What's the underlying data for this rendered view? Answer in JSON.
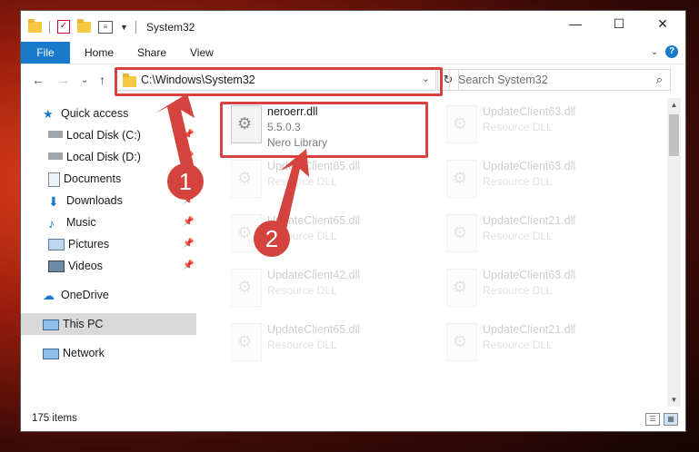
{
  "window": {
    "title": "System32"
  },
  "qat": {
    "icons": [
      "folder-icon",
      "properties-check-icon",
      "new-folder-icon",
      "customize-icon"
    ]
  },
  "ribbon": {
    "file": "File",
    "home": "Home",
    "share": "Share",
    "view": "View"
  },
  "address": {
    "path": "C:\\Windows\\System32"
  },
  "search": {
    "placeholder": "Search System32"
  },
  "sidebar": {
    "items": [
      {
        "label": "Quick access",
        "icon": "star-icon",
        "pinned": false
      },
      {
        "label": "Local Disk (C:)",
        "icon": "drive-icon",
        "pinned": true
      },
      {
        "label": "Local Disk (D:)",
        "icon": "drive-icon",
        "pinned": true
      },
      {
        "label": "Documents",
        "icon": "documents-icon",
        "pinned": true
      },
      {
        "label": "Downloads",
        "icon": "downloads-icon",
        "pinned": true
      },
      {
        "label": "Music",
        "icon": "music-icon",
        "pinned": true
      },
      {
        "label": "Pictures",
        "icon": "pictures-icon",
        "pinned": true
      },
      {
        "label": "Videos",
        "icon": "videos-icon",
        "pinned": true
      },
      {
        "label": "OneDrive",
        "icon": "cloud-icon",
        "pinned": false
      },
      {
        "label": "This PC",
        "icon": "computer-icon",
        "pinned": false
      },
      {
        "label": "Network",
        "icon": "network-icon",
        "pinned": false
      }
    ]
  },
  "files": [
    {
      "name": "neroerr.dll",
      "line2": "5.5.0.3",
      "line3": "Nero Library"
    },
    {
      "name": "UpdateClient63.dll",
      "line2": "Resource DLL",
      "line3": ""
    },
    {
      "name": "UpdateClient65.dll",
      "line2": "Resource DLL",
      "line3": ""
    },
    {
      "name": "UpdateClient63.dll",
      "line2": "Resource DLL",
      "line3": ""
    },
    {
      "name": "UpdateClient65.dll",
      "line2": "Resource DLL",
      "line3": ""
    },
    {
      "name": "UpdateClient21.dll",
      "line2": "Resource DLL",
      "line3": ""
    },
    {
      "name": "UpdateClient42.dll",
      "line2": "Resource DLL",
      "line3": ""
    },
    {
      "name": "UpdateClient63.dll",
      "line2": "Resource DLL",
      "line3": ""
    },
    {
      "name": "UpdateClient65.dll",
      "line2": "Resource DLL",
      "line3": ""
    },
    {
      "name": "UpdateClient21.dll",
      "line2": "Resource DLL",
      "line3": ""
    }
  ],
  "status": {
    "count": "175 items"
  },
  "annotations": {
    "step1": "1",
    "step2": "2",
    "color": "#d4433e"
  }
}
